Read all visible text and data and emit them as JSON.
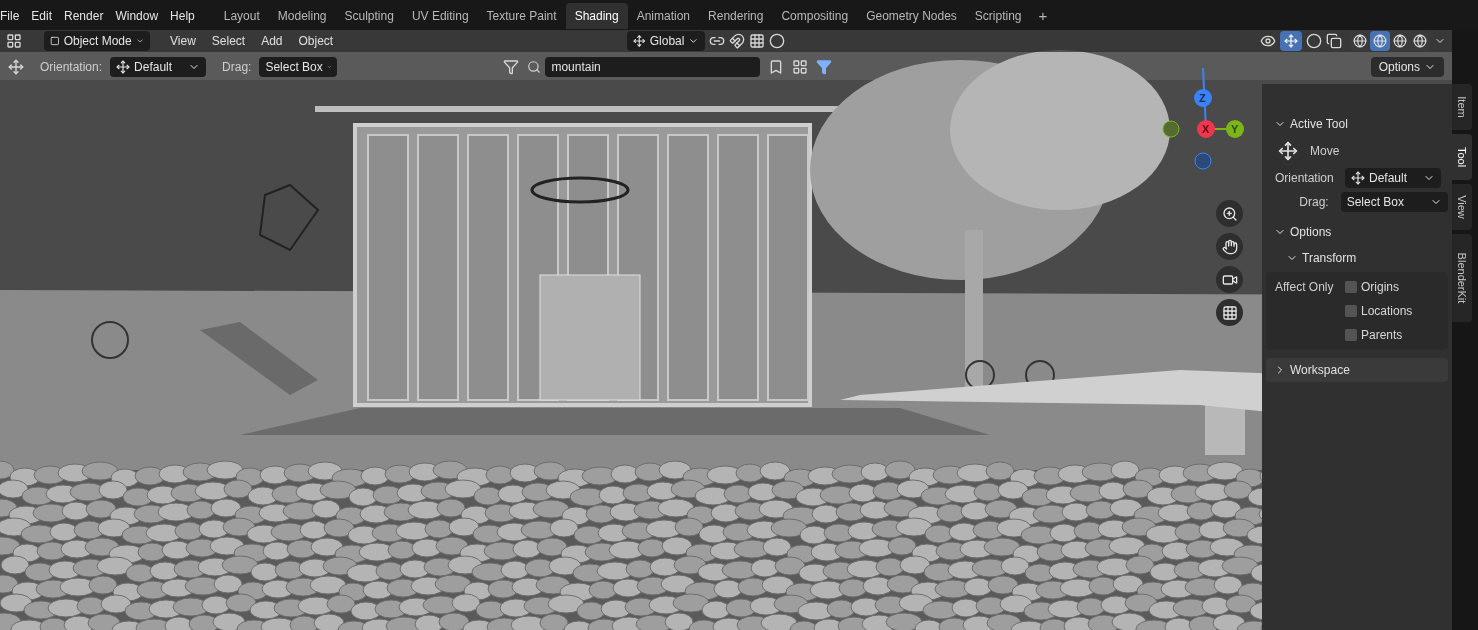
{
  "menu": [
    "File",
    "Edit",
    "Render",
    "Window",
    "Help"
  ],
  "workspaces": [
    {
      "label": "Layout",
      "selected": false
    },
    {
      "label": "Modeling",
      "selected": false
    },
    {
      "label": "Sculpting",
      "selected": false
    },
    {
      "label": "UV Editing",
      "selected": false
    },
    {
      "label": "Texture Paint",
      "selected": false
    },
    {
      "label": "Shading",
      "selected": true
    },
    {
      "label": "Animation",
      "selected": false
    },
    {
      "label": "Rendering",
      "selected": false
    },
    {
      "label": "Compositing",
      "selected": false
    },
    {
      "label": "Geometry Nodes",
      "selected": false
    },
    {
      "label": "Scripting",
      "selected": false
    }
  ],
  "add_workspace": "+",
  "header": {
    "mode": "Object Mode",
    "menus": [
      "View",
      "Select",
      "Add",
      "Object"
    ],
    "transform_orientation": "Global",
    "shading_modes": [
      {
        "selected": false
      },
      {
        "selected": true
      },
      {
        "selected": false
      },
      {
        "selected": false
      }
    ]
  },
  "tool_settings": {
    "orientation_label": "Orientation:",
    "orientation": "Default",
    "drag_label": "Drag:",
    "drag": "Select Box",
    "search": "mountain",
    "options": "Options"
  },
  "gizmo": {
    "axes": [
      "Z",
      "X",
      "Y"
    ]
  },
  "sidebar": {
    "tabs": [
      {
        "label": "Item",
        "selected": false
      },
      {
        "label": "Tool",
        "selected": true
      },
      {
        "label": "View",
        "selected": false
      },
      {
        "label": "BlenderKit",
        "selected": false
      }
    ],
    "active_tool": {
      "title": "Active Tool",
      "expanded": true,
      "tool": "Move",
      "orientation_label": "Orientation",
      "orientation": "Default",
      "drag_label": "Drag:",
      "drag": "Select Box"
    },
    "options": {
      "title": "Options",
      "expanded": true,
      "transform_title": "Transform",
      "transform_expanded": true,
      "affect_only_label": "Affect Only",
      "checkboxes": [
        {
          "label": "Origins",
          "checked": false
        },
        {
          "label": "Locations",
          "checked": false
        },
        {
          "label": "Parents",
          "checked": false
        }
      ]
    },
    "workspace": {
      "title": "Workspace",
      "expanded": false
    }
  }
}
